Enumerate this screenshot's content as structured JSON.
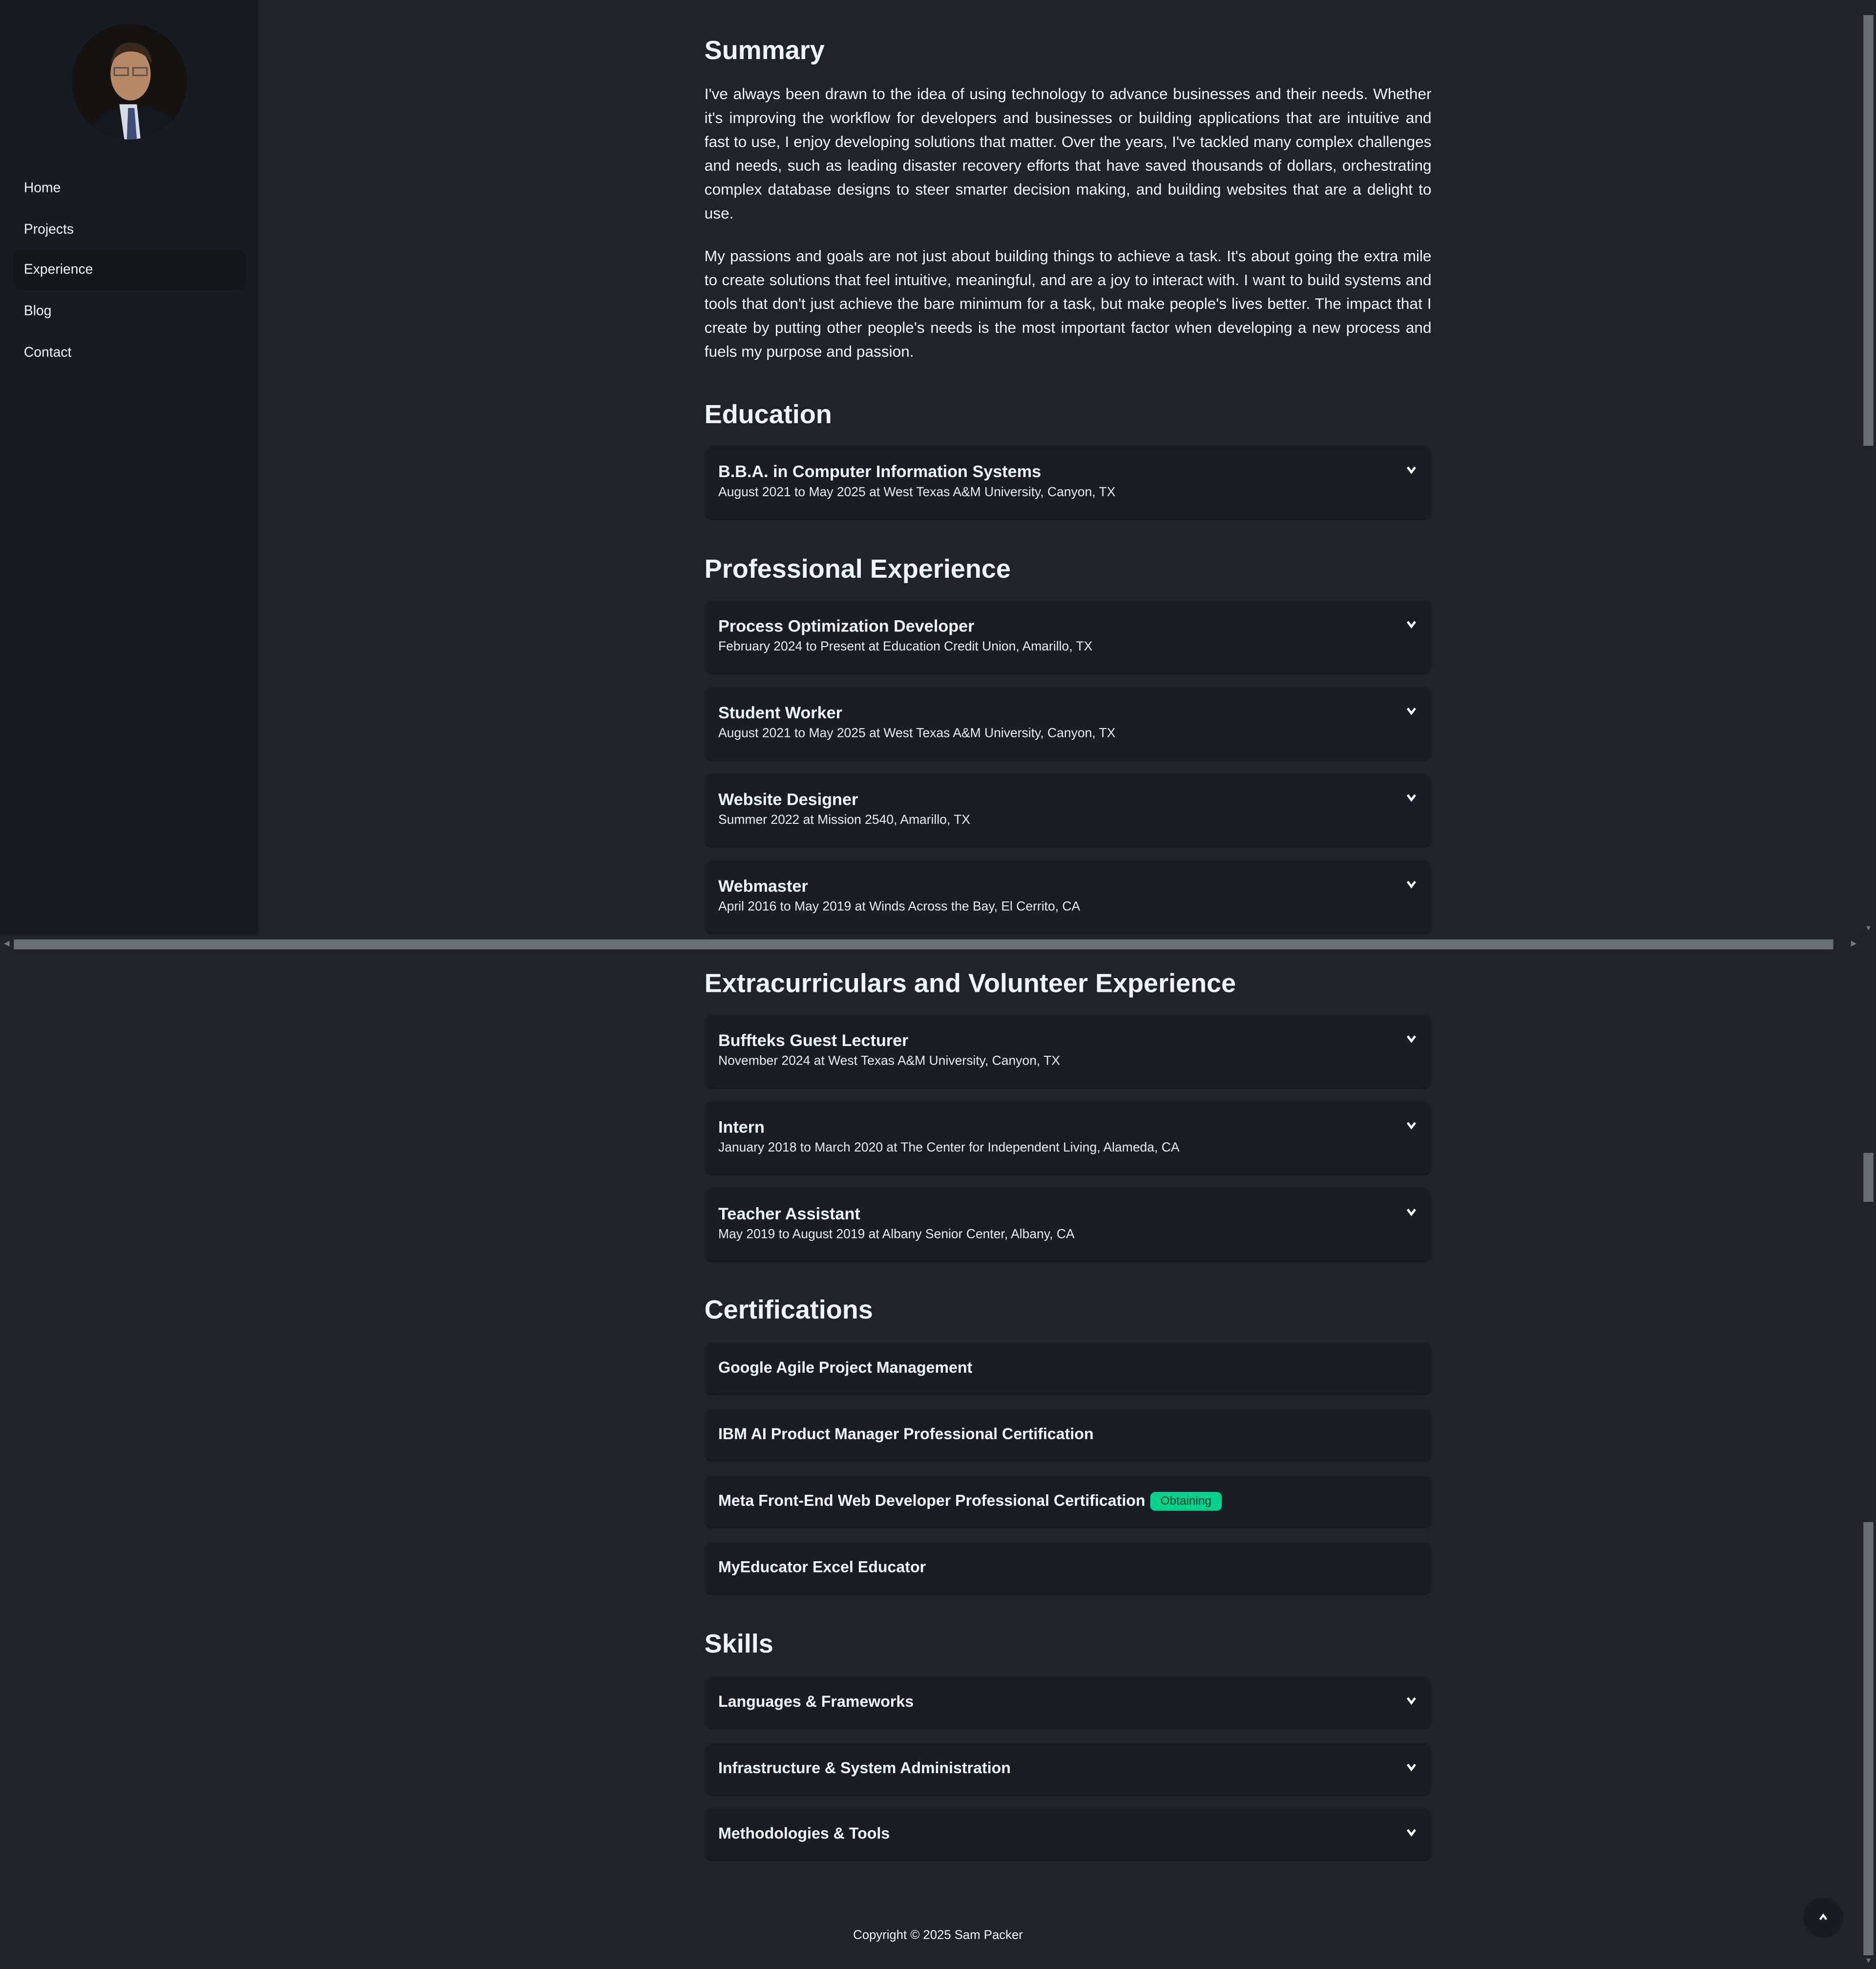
{
  "sidebar": {
    "nav": [
      {
        "label": "Home",
        "active": false
      },
      {
        "label": "Projects",
        "active": false
      },
      {
        "label": "Experience",
        "active": true
      },
      {
        "label": "Blog",
        "active": false
      },
      {
        "label": "Contact",
        "active": false
      }
    ]
  },
  "summary": {
    "heading": "Summary",
    "paragraphs": [
      "I've always been drawn to the idea of using technology to advance businesses and their needs. Whether it's improving the workflow for developers and businesses or building applications that are intuitive and fast to use, I enjoy developing solutions that matter. Over the years, I've tackled many complex challenges and needs, such as leading disaster recovery efforts that have saved thousands of dollars, orchestrating complex database designs to steer smarter decision making, and building websites that are a delight to use.",
      "My passions and goals are not just about building things to achieve a task. It's about going the extra mile to create solutions that feel intuitive, meaningful, and are a joy to interact with. I want to build systems and tools that don't just achieve the bare minimum for a task, but make people's lives better. The impact that I create by putting other people's needs is the most important factor when developing a new process and fuels my purpose and passion."
    ]
  },
  "education": {
    "heading": "Education",
    "items": [
      {
        "title": "B.B.A. in Computer Information Systems",
        "subtitle": "August 2021 to May 2025 at West Texas A&M University, Canyon, TX"
      }
    ]
  },
  "professional": {
    "heading": "Professional Experience",
    "items": [
      {
        "title": "Process Optimization Developer",
        "subtitle": "February 2024 to Present at Education Credit Union, Amarillo, TX"
      },
      {
        "title": "Student Worker",
        "subtitle": "August 2021 to May 2025 at West Texas A&M University, Canyon, TX"
      },
      {
        "title": "Website Designer",
        "subtitle": "Summer 2022 at Mission 2540, Amarillo, TX"
      },
      {
        "title": "Webmaster",
        "subtitle": "April 2016 to May 2019 at Winds Across the Bay, El Cerrito, CA"
      }
    ]
  },
  "extracurricular": {
    "heading": "Extracurriculars and Volunteer Experience",
    "items": [
      {
        "title": "Buffteks Guest Lecturer",
        "subtitle": "November 2024 at West Texas A&M University, Canyon, TX"
      },
      {
        "title": "Intern",
        "subtitle": "January 2018 to March 2020 at The Center for Independent Living, Alameda, CA"
      },
      {
        "title": "Teacher Assistant",
        "subtitle": "May 2019 to August 2019 at Albany Senior Center, Albany, CA"
      }
    ]
  },
  "certifications": {
    "heading": "Certifications",
    "items": [
      {
        "title": "Google Agile Project Management"
      },
      {
        "title": "IBM AI Product Manager Professional Certification"
      },
      {
        "title": "Meta Front-End Web Developer Professional Certification",
        "badge": "Obtaining"
      },
      {
        "title": "MyEducator Excel Educator"
      }
    ]
  },
  "skills": {
    "heading": "Skills",
    "items": [
      {
        "title": "Languages & Frameworks"
      },
      {
        "title": "Infrastructure & System Administration"
      },
      {
        "title": "Methodologies & Tools"
      }
    ]
  },
  "footer": {
    "copyright": "Copyright © 2025 Sam Packer"
  },
  "colors": {
    "background": "#1f232b",
    "sidebar": "#181d25",
    "card": "#191e26",
    "badge": "#00d18b",
    "scrollbar": "#676e76"
  },
  "icons": {
    "card_toggle": "chevron-down-icon",
    "back_to_top": "chevron-up-icon"
  }
}
